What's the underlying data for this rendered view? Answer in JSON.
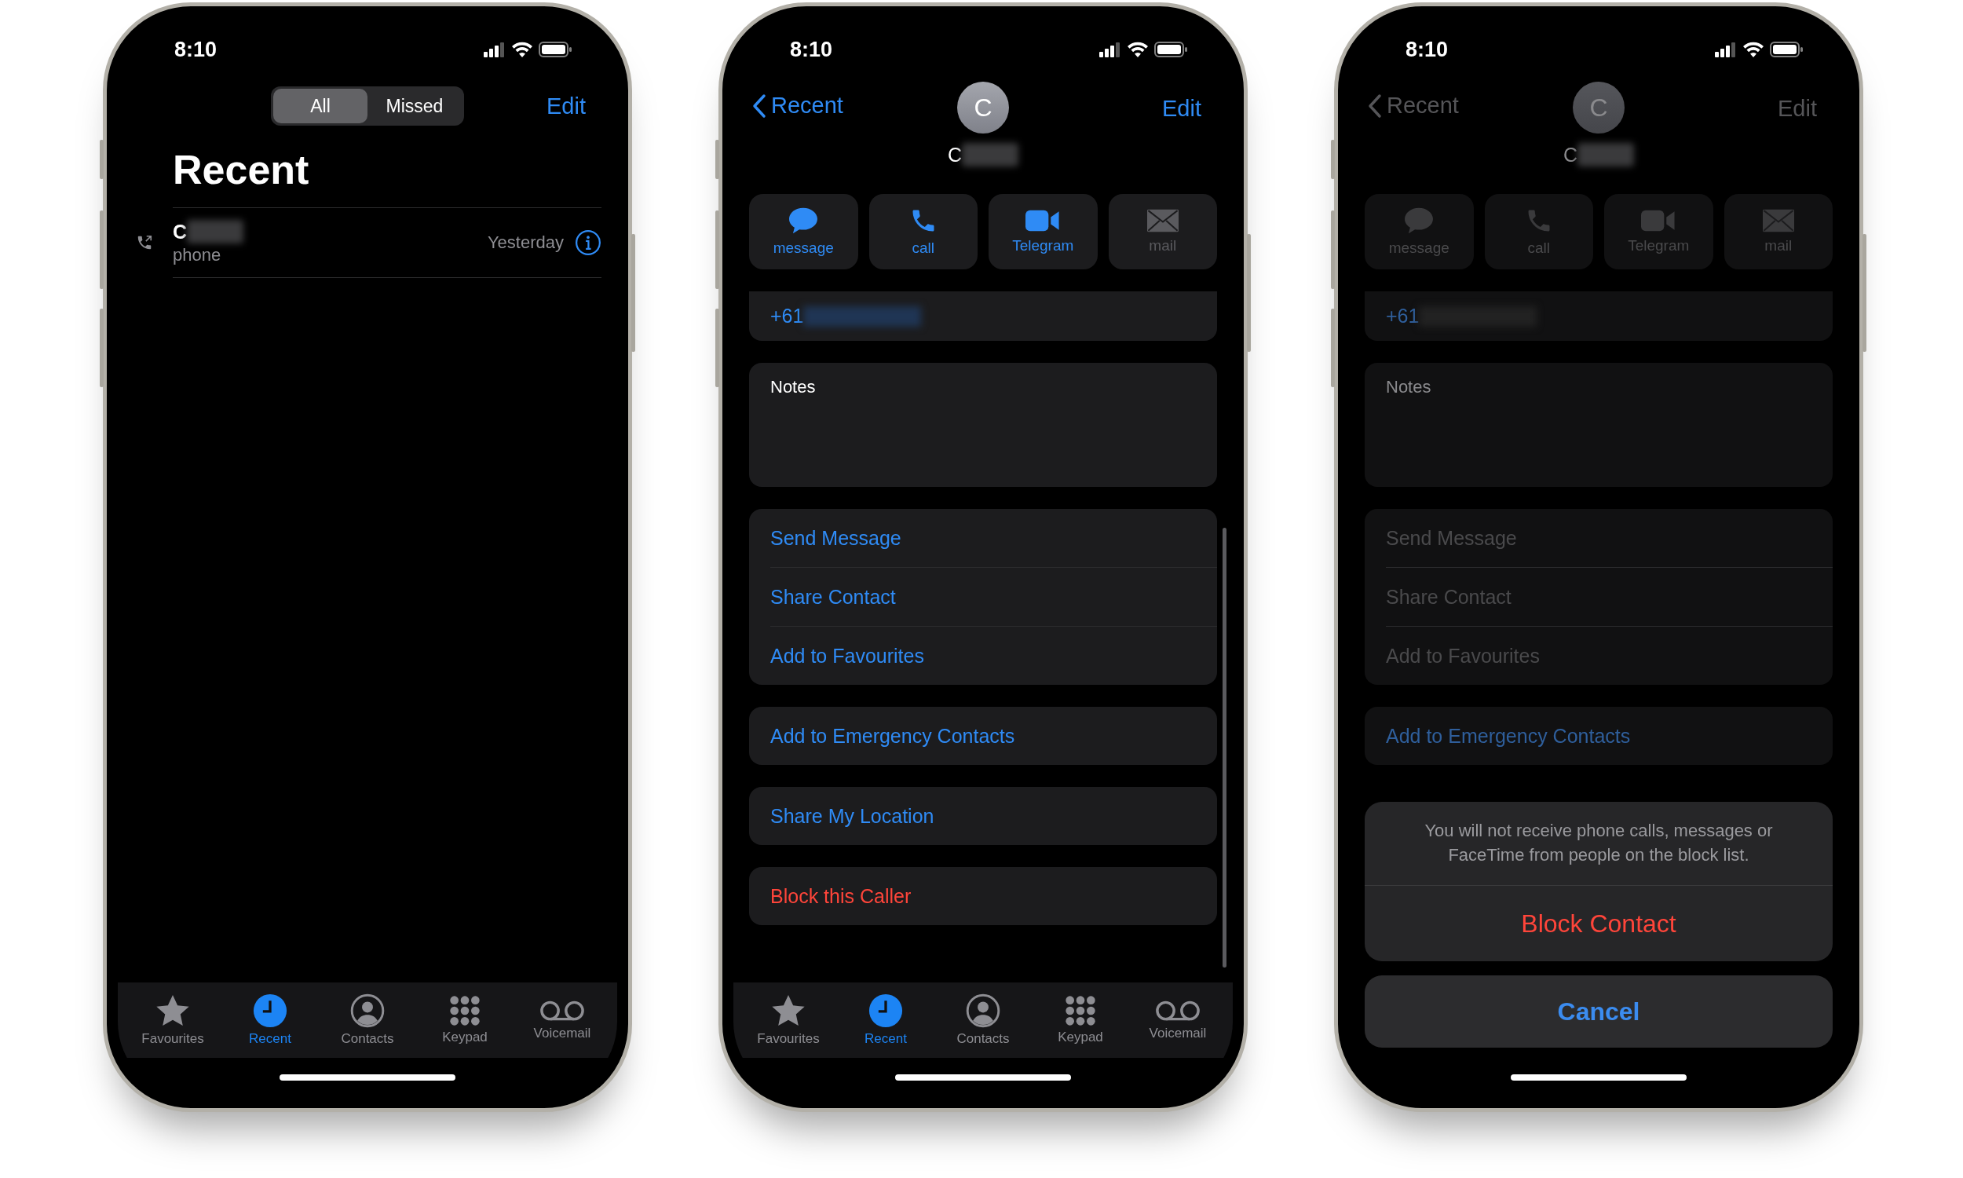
{
  "phones": [
    {
      "kind": "recents",
      "status_time": "8:10",
      "segments": [
        {
          "label": "All",
          "selected": true
        },
        {
          "label": "Missed",
          "selected": false
        }
      ],
      "edit": "Edit",
      "title": "Recent",
      "calls": [
        {
          "name": "C",
          "type": "phone",
          "time": "Yesterday"
        }
      ],
      "tabs": [
        {
          "kind": "favourites",
          "label": "Favourites",
          "selected": false
        },
        {
          "kind": "recent",
          "label": "Recent",
          "selected": true
        },
        {
          "kind": "contacts",
          "label": "Contacts",
          "selected": false
        },
        {
          "kind": "keypad",
          "label": "Keypad",
          "selected": false
        },
        {
          "kind": "voicemail",
          "label": "Voicemail",
          "selected": false
        }
      ]
    },
    {
      "kind": "contact",
      "dimmed": false,
      "status_time": "8:10",
      "back": "Recent",
      "edit": "Edit",
      "avatar": "C",
      "name": "C",
      "actions": [
        {
          "kind": "message",
          "label": "message",
          "disabled": false
        },
        {
          "kind": "call",
          "label": "call",
          "disabled": false
        },
        {
          "kind": "video",
          "label": "Telegram",
          "disabled": false
        },
        {
          "kind": "mail",
          "label": "mail",
          "disabled": true
        }
      ],
      "phone_number": "+61",
      "notes_label": "Notes",
      "groups": [
        {
          "rows": [
            {
              "label": "Send Message",
              "disabled": false,
              "destructive": false
            },
            {
              "label": "Share Contact",
              "disabled": false,
              "destructive": false
            },
            {
              "label": "Add to Favourites",
              "disabled": false,
              "destructive": false
            }
          ]
        },
        {
          "rows": [
            {
              "label": "Add to Emergency Contacts",
              "disabled": false,
              "destructive": false
            }
          ]
        },
        {
          "rows": [
            {
              "label": "Share My Location",
              "disabled": false,
              "destructive": false
            }
          ]
        },
        {
          "rows": [
            {
              "label": "Block this Caller",
              "disabled": false,
              "destructive": true
            }
          ]
        }
      ],
      "tabs": [
        {
          "kind": "favourites",
          "label": "Favourites",
          "selected": false
        },
        {
          "kind": "recent",
          "label": "Recent",
          "selected": true
        },
        {
          "kind": "contacts",
          "label": "Contacts",
          "selected": false
        },
        {
          "kind": "keypad",
          "label": "Keypad",
          "selected": false
        },
        {
          "kind": "voicemail",
          "label": "Voicemail",
          "selected": false
        }
      ]
    },
    {
      "kind": "contact",
      "dimmed": true,
      "status_time": "8:10",
      "back": "Recent",
      "edit": "Edit",
      "avatar": "C",
      "name": "C",
      "actions": [
        {
          "kind": "message",
          "label": "message",
          "disabled": true
        },
        {
          "kind": "call",
          "label": "call",
          "disabled": true
        },
        {
          "kind": "video",
          "label": "Telegram",
          "disabled": true
        },
        {
          "kind": "mail",
          "label": "mail",
          "disabled": true
        }
      ],
      "phone_number": "+61",
      "notes_label": "Notes",
      "groups": [
        {
          "rows": [
            {
              "label": "Send Message",
              "disabled": true,
              "destructive": false
            },
            {
              "label": "Share Contact",
              "disabled": true,
              "destructive": false
            },
            {
              "label": "Add to Favourites",
              "disabled": true,
              "destructive": false
            }
          ]
        },
        {
          "rows": [
            {
              "label": "Add to Emergency Contacts",
              "disabled": false,
              "destructive": false
            }
          ]
        }
      ],
      "sheet": {
        "message": "You will not receive phone calls, messages or FaceTime from people on the block list.",
        "confirm": "Block Contact",
        "cancel": "Cancel"
      }
    }
  ]
}
